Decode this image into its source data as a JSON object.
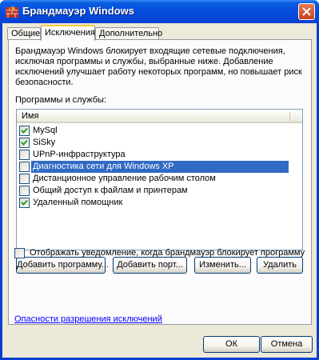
{
  "window": {
    "title": "Брандмауэр Windows"
  },
  "tabs": [
    {
      "label": "Общие"
    },
    {
      "label": "Исключения"
    },
    {
      "label": "Дополнительно"
    }
  ],
  "exceptions": {
    "description": "Брандмауэр Windows блокирует входящие сетевые подключения, исключая программы и службы, выбранные ниже. Добавление исключений улучшает работу некоторых программ, но повышает риск безопасности.",
    "list_label": "Программы и службы:",
    "column_header": "Имя",
    "items": [
      {
        "label": "MySql",
        "checked": true
      },
      {
        "label": "SiSky",
        "checked": true
      },
      {
        "label": "UPnP-инфраструктура",
        "checked": false
      },
      {
        "label": "Диагностика сети для Windows XP",
        "checked": false
      },
      {
        "label": "Дистанционное управление рабочим столом",
        "checked": false
      },
      {
        "label": "Общий доступ к файлам и принтерам",
        "checked": false
      },
      {
        "label": "Удаленный помощник",
        "checked": true
      }
    ],
    "selected_item": "Диагностика сети для Windows XP",
    "buttons": {
      "add_program": "Добавить программу...",
      "add_port": "Добавить порт...",
      "edit": "Изменить...",
      "delete": "Удалить"
    },
    "notify_label": "Отображать уведомление, когда брандмауэр блокирует программу",
    "notify_checked": false,
    "risk_link": "Опасности разрешения исключений"
  },
  "dialog_buttons": {
    "ok": "ОК",
    "cancel": "Отмена"
  },
  "colors": {
    "titlebar": "#0a5ee0",
    "dialog_bg": "#ece9d8",
    "selection": "#316ac5",
    "link": "#0000ff",
    "active_tab_accent": "#ffc83c"
  }
}
